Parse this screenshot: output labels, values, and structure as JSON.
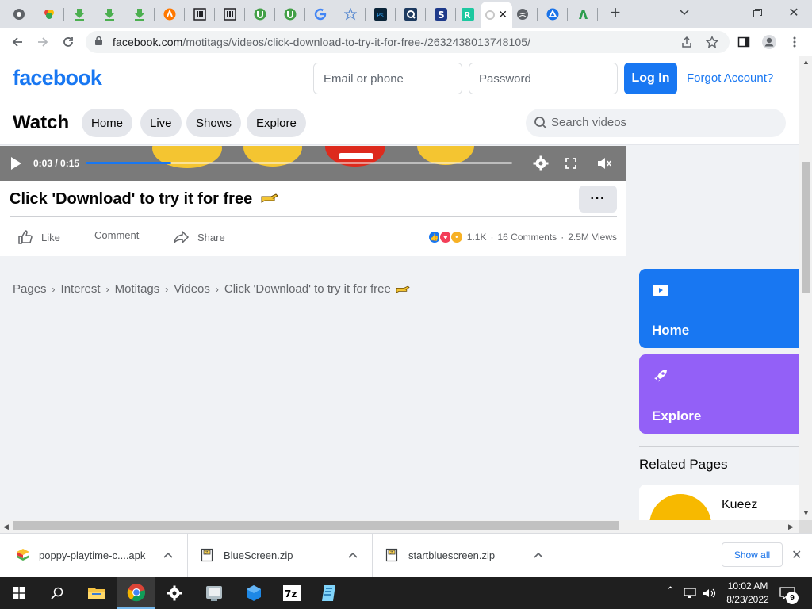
{
  "browser": {
    "tabs": [
      {
        "icon": "chrome-icon"
      },
      {
        "icon": "photos-icon"
      },
      {
        "icon": "download-icon"
      },
      {
        "icon": "download-icon"
      },
      {
        "icon": "download-icon"
      },
      {
        "icon": "avast-icon"
      },
      {
        "icon": "archive-icon"
      },
      {
        "icon": "archive-icon"
      },
      {
        "icon": "utorrent-icon"
      },
      {
        "icon": "utorrent-icon"
      },
      {
        "icon": "google-icon"
      },
      {
        "icon": "star-icon"
      },
      {
        "icon": "photoshop-icon"
      },
      {
        "icon": "q-icon"
      },
      {
        "icon": "s-icon"
      },
      {
        "icon": "r-icon"
      },
      {
        "icon": "globe-icon"
      },
      {
        "icon": "triangle-icon"
      },
      {
        "icon": "green-leaf-icon"
      }
    ],
    "active_tab_icon": "facebook-icon",
    "url_host": "facebook.com",
    "url_path": "/motitags/videos/click-download-to-try-it-for-free-/2632438013748105/"
  },
  "header": {
    "logo": "facebook",
    "email_placeholder": "Email or phone",
    "password_placeholder": "Password",
    "login_label": "Log In",
    "forgot_label": "Forgot Account?"
  },
  "watch": {
    "title": "Watch",
    "nav": [
      "Home",
      "Live",
      "Shows",
      "Explore"
    ],
    "search_placeholder": "Search videos"
  },
  "player": {
    "timecode": "0:03 / 0:15",
    "progress": 0.2
  },
  "post": {
    "title": "Click 'Download' to try it for free",
    "actions": {
      "like": "Like",
      "comment": "Comment",
      "share": "Share"
    },
    "reactions_count": "1.1K",
    "comments": "16 Comments",
    "views": "2.5M Views",
    "dot": "·"
  },
  "breadcrumb": [
    "Pages",
    "Interest",
    "Motitags",
    "Videos",
    "Click 'Download' to try it for free"
  ],
  "sidebar": {
    "home_label": "Home",
    "explore_label": "Explore",
    "related_heading": "Related Pages",
    "related_name": "Kueez"
  },
  "downloads": [
    {
      "name": "poppy-playtime-c....apk"
    },
    {
      "name": "BlueScreen.zip"
    },
    {
      "name": "startbluescreen.zip"
    }
  ],
  "download_shelf": {
    "show_all": "Show all"
  },
  "taskbar": {
    "time": "10:02 AM",
    "date": "8/23/2022",
    "notifications": "9"
  },
  "colors": {
    "facebook_blue": "#1877f2",
    "explore_purple": "#9360f7"
  }
}
